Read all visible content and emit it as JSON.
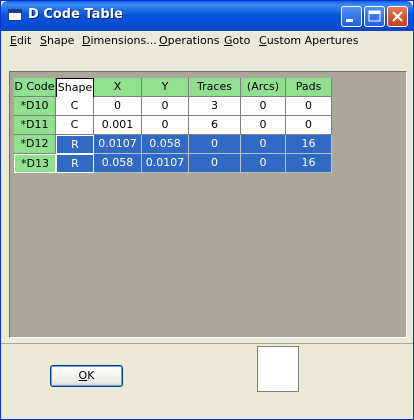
{
  "window": {
    "title": "D Code Table"
  },
  "menu": {
    "items": [
      {
        "label": "Edit",
        "accel": "E",
        "rest": "dit"
      },
      {
        "label": "Shape",
        "accel": "S",
        "rest": "hape"
      },
      {
        "label": "Dimensions...",
        "accel": "D",
        "rest": "imensions..."
      },
      {
        "label": "Operations",
        "accel": "O",
        "rest": "perations"
      },
      {
        "label": "Goto",
        "accel": "G",
        "rest": "oto"
      },
      {
        "label": "Custom Apertures",
        "accel": "C",
        "rest": "ustom Apertures"
      }
    ]
  },
  "table": {
    "headers": [
      "D Code",
      "Shape",
      "X",
      "Y",
      "Traces",
      "(Arcs)",
      "Pads"
    ],
    "rows": [
      {
        "dcode": "*D10",
        "shape": "C",
        "x": "0",
        "y": "0",
        "traces": "3",
        "arcs": "0",
        "pads": "0",
        "selected": false
      },
      {
        "dcode": "*D11",
        "shape": "C",
        "x": "0.001",
        "y": "0",
        "traces": "6",
        "arcs": "0",
        "pads": "0",
        "selected": false
      },
      {
        "dcode": "*D12",
        "shape": "R",
        "x": "0.0107",
        "y": "0.058",
        "traces": "0",
        "arcs": "0",
        "pads": "16",
        "selected": true
      },
      {
        "dcode": "*D13",
        "shape": "R",
        "x": "0.058",
        "y": "0.0107",
        "traces": "0",
        "arcs": "0",
        "pads": "16",
        "selected": true
      }
    ]
  },
  "buttons": {
    "ok_label": "OK",
    "ok_accel": "O",
    "ok_rest": "K"
  },
  "colors": {
    "title_bar": "#0856dd",
    "header_green": "#90e090",
    "selection_blue": "#316ac5",
    "grid_background": "#aca899",
    "window_face": "#ece9d8"
  },
  "icons": {
    "app": "window-icon",
    "minimize": "minimize-icon",
    "maximize": "maximize-icon",
    "close": "close-icon"
  }
}
